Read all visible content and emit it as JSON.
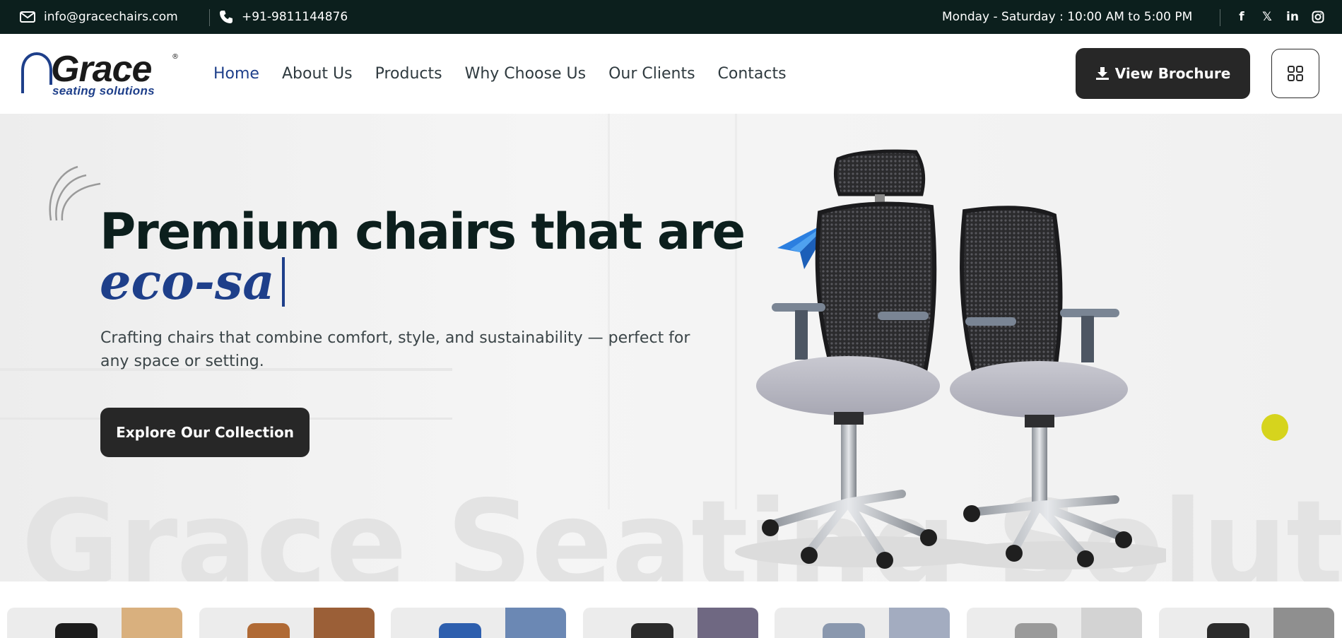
{
  "topbar": {
    "email": "info@gracechairs.com",
    "phone": "+91-9811144876",
    "hours": "Monday - Saturday : 10:00 AM to 5:00 PM",
    "social": [
      {
        "icon": "facebook-icon",
        "glyph": "f"
      },
      {
        "icon": "x-twitter-icon",
        "glyph": "𝕏"
      },
      {
        "icon": "linkedin-icon",
        "glyph": "in"
      },
      {
        "icon": "instagram-icon",
        "glyph": "◎"
      }
    ]
  },
  "logo": {
    "word": "Grace",
    "tagline": "seating solutions",
    "reg": "®"
  },
  "nav": {
    "items": [
      "Home",
      "About Us",
      "Products",
      "Why Choose Us",
      "Our Clients",
      "Contacts"
    ],
    "active": "Home"
  },
  "header": {
    "brochure_label": "View Brochure"
  },
  "hero": {
    "title": "Premium chairs that are",
    "typed": "eco-sa",
    "description": "Crafting chairs that combine comfort, style, and sustainability — perfect for any space or setting.",
    "cta_label": "Explore Our Collection",
    "watermark": "Grace Seating Solutions"
  },
  "colors": {
    "topbar_bg": "#0c1f1d",
    "accent_blue": "#1e3f8a",
    "button_dark": "#272727",
    "dot_yellow": "#d6d41d"
  },
  "product_strip": {
    "cards": [
      {
        "swatch": "#d9b07e",
        "product": "#1c1c1c"
      },
      {
        "swatch": "#9b5f37",
        "product": "#b06a35"
      },
      {
        "swatch": "#6b88b4",
        "product": "#2e5fae"
      },
      {
        "swatch": "#6f6882",
        "product": "#2b2b2b"
      },
      {
        "swatch": "#a3acc0",
        "product": "#8a98ae"
      },
      {
        "swatch": "#d3d3d3",
        "product": "#9a9a9a"
      },
      {
        "swatch": "#8f8f8f",
        "product": "#2b2b2b"
      }
    ]
  }
}
